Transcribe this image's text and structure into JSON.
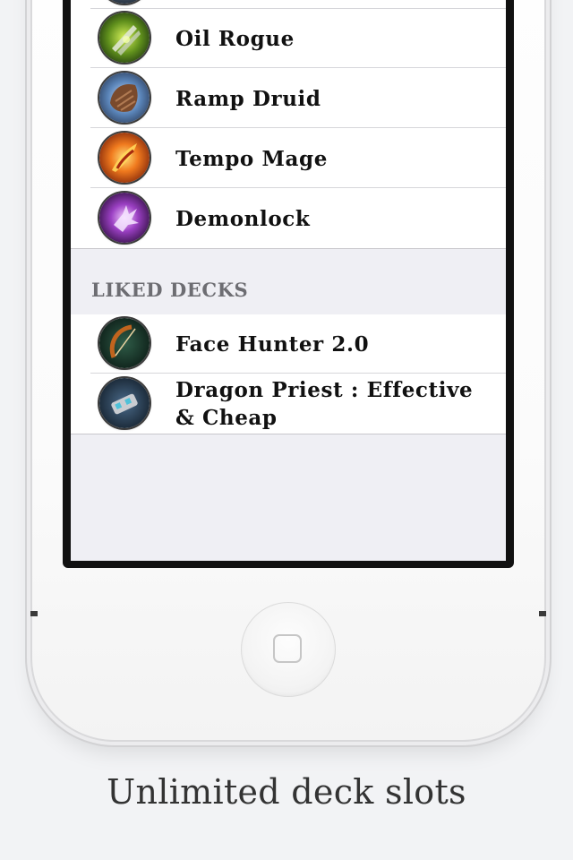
{
  "deck_list": {
    "items": [
      {
        "label": "Oil Rogue",
        "icon": "oil-rogue-icon"
      },
      {
        "label": "Ramp Druid",
        "icon": "ramp-druid-icon"
      },
      {
        "label": "Tempo Mage",
        "icon": "tempo-mage-icon"
      },
      {
        "label": "Demonlock",
        "icon": "demonlock-icon"
      }
    ]
  },
  "liked_section": {
    "header": "LIKED DECKS",
    "items": [
      {
        "label": "Face Hunter 2.0",
        "icon": "face-hunter-icon"
      },
      {
        "label": "Dragon Priest : Effective & Cheap",
        "icon": "dragon-priest-icon"
      }
    ]
  },
  "caption": "Unlimited deck slots",
  "colors": {
    "background": "#f2f3f5",
    "screen_background": "#efeff4",
    "section_header_text": "#6d6d72",
    "row_text": "#111111"
  }
}
